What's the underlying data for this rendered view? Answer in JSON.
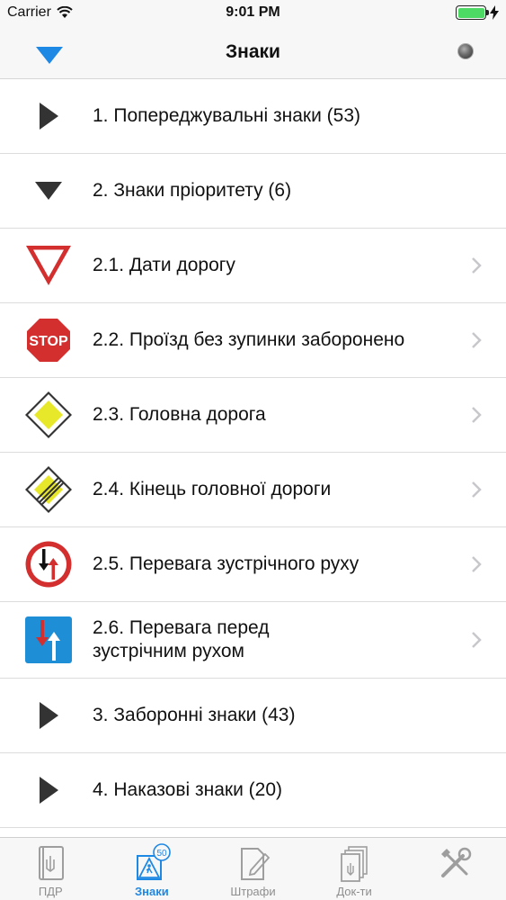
{
  "status_bar": {
    "carrier": "Carrier",
    "time": "9:01 PM"
  },
  "nav": {
    "title": "Знаки"
  },
  "list": {
    "rows": [
      {
        "label": "1. Попереджувальні знаки (53)"
      },
      {
        "label": "2. Знаки пріоритету (6)"
      },
      {
        "label": "2.1. Дати дорогу"
      },
      {
        "label": "2.2. Проїзд без зупинки заборонено",
        "sign_text": "STOP"
      },
      {
        "label": "2.3. Головна дорога"
      },
      {
        "label": "2.4. Кінець головної дороги"
      },
      {
        "label": "2.5. Перевага зустрічного руху"
      },
      {
        "label": "2.6. Перевага перед зустрічним рухом"
      },
      {
        "label": "3. Заборонні знаки (43)"
      },
      {
        "label": "4. Наказові знаки (20)"
      }
    ]
  },
  "tabs": [
    {
      "label": "ПДР"
    },
    {
      "label": "Знаки",
      "badge": "50"
    },
    {
      "label": "Штрафи"
    },
    {
      "label": "Док-ти"
    },
    {
      "label": ""
    }
  ],
  "colors": {
    "accent": "#1e88e5",
    "battery": "#4cd964",
    "sign_red": "#d32f2f",
    "sign_yellow": "#e8e82a",
    "sign_blue": "#1e8fd6"
  }
}
